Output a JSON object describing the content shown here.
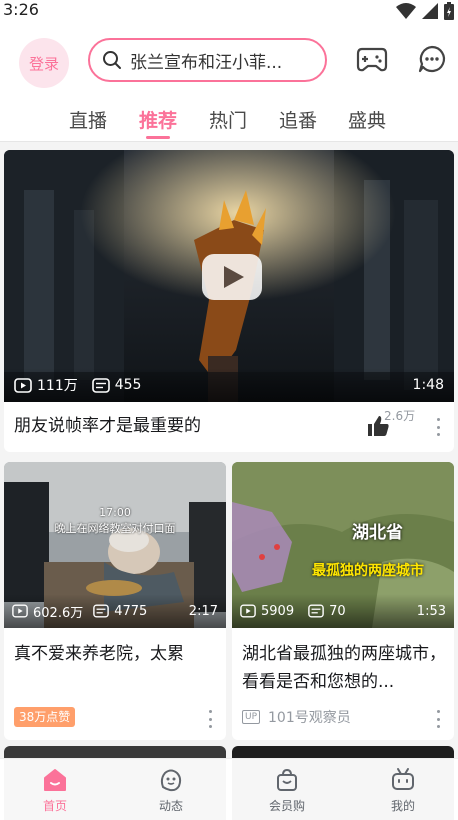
{
  "status_bar": {
    "time": "3:26"
  },
  "header": {
    "login_label": "登录",
    "search_text": "张兰宣布和汪小菲..."
  },
  "tabs": [
    {
      "label": "直播"
    },
    {
      "label": "推荐"
    },
    {
      "label": "热门"
    },
    {
      "label": "追番"
    },
    {
      "label": "盛典"
    }
  ],
  "feed": {
    "featured": {
      "views": "111万",
      "danmaku": "455",
      "duration": "1:48",
      "title": "朋友说帧率才是最重要的",
      "likes": "2.6万"
    },
    "left_card": {
      "overlay_time": "17:00",
      "overlay_caption": "晚上在网络教室对付口面",
      "views": "602.6万",
      "danmaku": "4775",
      "duration": "2:17",
      "title": "真不爱来养老院，太累",
      "badge": "38万点赞"
    },
    "right_card": {
      "overlay_province": "湖北省",
      "overlay_caption": "最孤独的两座城市",
      "views": "5909",
      "danmaku": "70",
      "duration": "1:53",
      "title": "湖北省最孤独的两座城市，看看是否和您想的...",
      "up_badge": "UP",
      "author": "101号观察员"
    }
  },
  "bottom_nav": [
    {
      "label": "首页",
      "icon": "home-icon"
    },
    {
      "label": "动态",
      "icon": "dynamic-icon"
    },
    {
      "label": "会员购",
      "icon": "shop-icon"
    },
    {
      "label": "我的",
      "icon": "tv-icon"
    }
  ],
  "colors": {
    "accent": "#fb7299",
    "badge_bg": "#ff9f6b"
  }
}
